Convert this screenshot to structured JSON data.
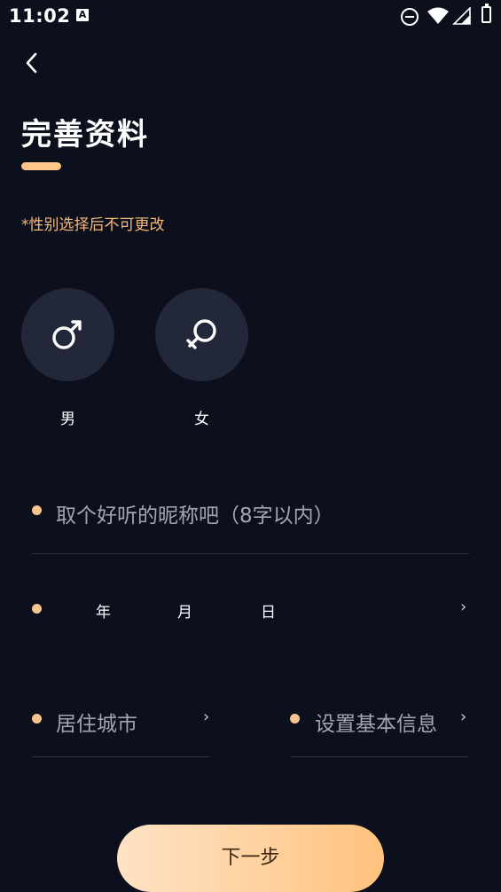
{
  "status_bar": {
    "time": "11:02",
    "notification_glyph": "A"
  },
  "header": {
    "title": "完善资料"
  },
  "notice": "*性别选择后不可更改",
  "gender": {
    "male_label": "男",
    "female_label": "女"
  },
  "form": {
    "nickname_placeholder": "取个好听的昵称吧（8字以内）",
    "birthday": {
      "year_unit": "年",
      "month_unit": "月",
      "day_unit": "日"
    },
    "city_placeholder": "居住城市",
    "basic_info_placeholder": "设置基本信息",
    "chevron": "›"
  },
  "actions": {
    "next_label": "下一步"
  },
  "colors": {
    "background": "#0c0f1c",
    "accent": "#ffc68a",
    "notice": "#f6b97a",
    "circle": "#23273a"
  }
}
